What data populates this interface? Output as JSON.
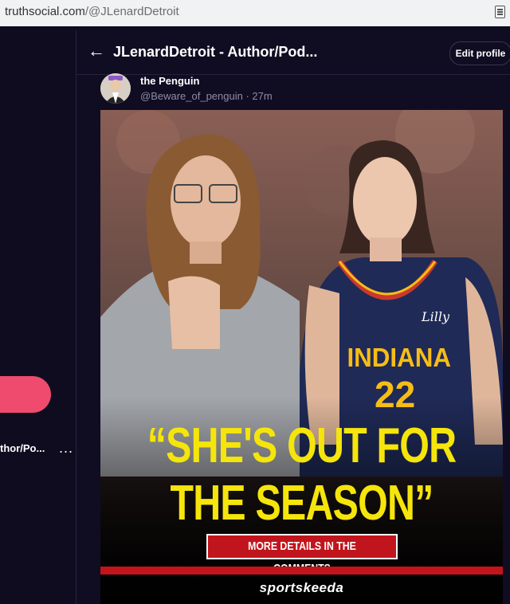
{
  "browser": {
    "url_domain": "truthsocial.com",
    "url_path": "/@JLenardDetroit"
  },
  "sidebar": {
    "profile_name": "thor/Po...",
    "more_label": "..."
  },
  "header": {
    "back_icon": "arrow-left-icon",
    "title": "JLenardDetroit - Author/Pod...",
    "edit_profile_label": "Edit profile"
  },
  "post": {
    "display_name": "the Penguin",
    "handle": "@Beware_of_penguin",
    "time": "· 27m",
    "image": {
      "headline_line1": "“SHE'S OUT FOR",
      "headline_line2": "THE SEASON”",
      "details_label": "MORE DETAILS IN THE COMMENTS",
      "brand": "sportskeeda",
      "jersey_text": "INDIANA",
      "jersey_number": "22",
      "jersey_sponsor": "Lilly"
    }
  },
  "colors": {
    "background": "#100d22",
    "accent_pink": "#ef4b6f",
    "headline_yellow": "#f5e50b",
    "banner_red": "#c1151d"
  }
}
